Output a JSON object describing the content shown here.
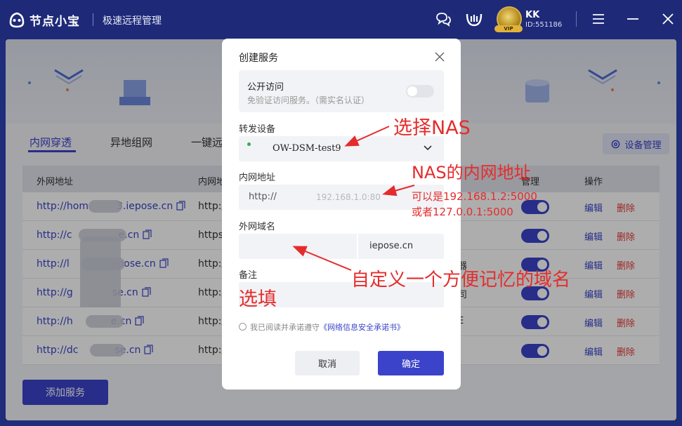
{
  "titlebar": {
    "app_name": "节点小宝",
    "subtitle": "极速远程管理",
    "user_name": "KK",
    "user_id": "ID:551186",
    "vip": "VIP"
  },
  "tabs": [
    "内网穿透",
    "异地组网",
    "一键远"
  ],
  "device_mgmt_label": "设备管理",
  "table": {
    "headers": {
      "ext": "外网地址",
      "int": "内网地",
      "manage": "管理",
      "ops": "操作"
    },
    "rows": [
      {
        "ext_a": "http://hom",
        "ext_b": "3.iepose.cn",
        "int": "http:/",
        "extra": ""
      },
      {
        "ext_a": "http://c",
        "ext_b": "e.cn",
        "int": "https",
        "extra": ""
      },
      {
        "ext_a": "http://l",
        "ext_b": "epose.cn",
        "int": "http:/",
        "extra": "器"
      },
      {
        "ext_a": "http://g",
        "ext_b": "se.cn",
        "int": "http:/",
        "extra": "司"
      },
      {
        "ext_a": "http://h",
        "ext_b": "e.cn",
        "int": "http:/",
        "extra": "E"
      },
      {
        "ext_a": "http://dc",
        "ext_b": "se.cn",
        "int": "http:/",
        "extra": ""
      }
    ],
    "edit_label": "编辑",
    "delete_label": "删除"
  },
  "add_service_label": "添加服务",
  "modal": {
    "title": "创建服务",
    "public_access_label": "公开访问",
    "public_access_desc": "免验证访问服务。（需实名认证）",
    "device_label": "转发设备",
    "device_value": "OW-DSM-test9",
    "internal_label": "内网地址",
    "protocol": "http://",
    "ip_placeholder": "192.168.1.0:80",
    "domain_label": "外网域名",
    "domain_suffix": "iepose.cn",
    "note_label": "备注",
    "agree_text": "我已阅读并承诺遵守",
    "agree_link": "《网络信息安全承诺书》",
    "cancel_label": "取消",
    "ok_label": "确定"
  },
  "annotations": {
    "choose_nas": "选择NAS",
    "nas_addr": "NAS的内网地址",
    "example1": "可以是192.168.1.2:5000",
    "example2": "或者127.0.0.1:5000",
    "custom_domain": "自定义一个方便记忆的域名",
    "optional": "选填"
  }
}
